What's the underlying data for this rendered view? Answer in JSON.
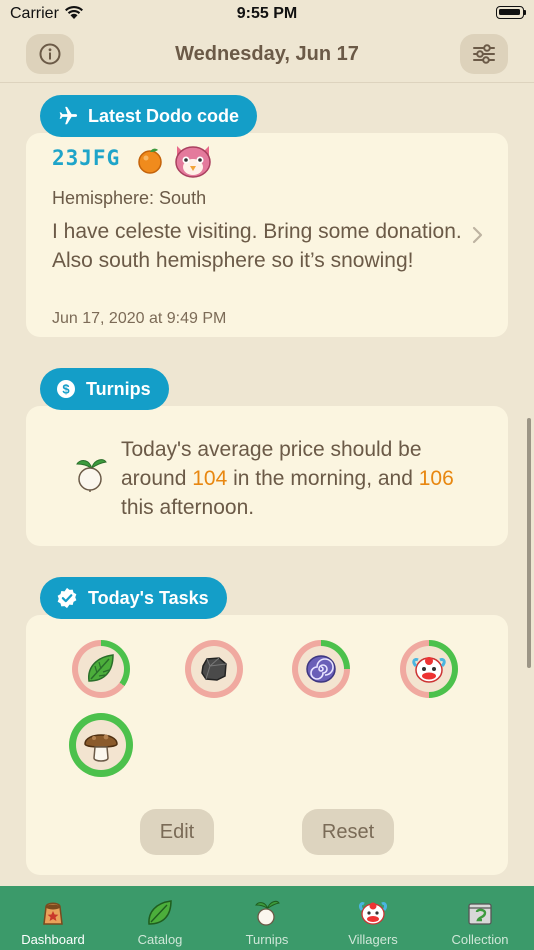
{
  "status": {
    "carrier": "Carrier",
    "time": "9:55 PM"
  },
  "nav": {
    "title": "Wednesday, Jun 17"
  },
  "dodo": {
    "header": "Latest Dodo code",
    "code": "23JFG",
    "hemisphere": "Hemisphere: South",
    "message": "I have celeste visiting. Bring some donation. Also south hemisphere so it’s snowing!",
    "date": "Jun 17, 2020 at 9:49 PM"
  },
  "turnips": {
    "header": "Turnips",
    "text_before": "Today's average price should be around ",
    "morning_price": "104",
    "text_middle": " in the morning, and ",
    "afternoon_price": "106",
    "text_after": " this afternoon."
  },
  "tasks": {
    "header": "Today's Tasks",
    "items": [
      {
        "icon": "leaf-icon",
        "progress": 0.35,
        "ring_color": "#4cc14c"
      },
      {
        "icon": "rock-icon",
        "progress": 0.0,
        "ring_color": "#4cc14c"
      },
      {
        "icon": "fossil-icon",
        "progress": 0.25,
        "ring_color": "#4cc14c"
      },
      {
        "icon": "balloon-icon",
        "progress": 0.5,
        "ring_color": "#4cc14c"
      },
      {
        "icon": "mushroom-icon",
        "progress": 1.0,
        "ring_color": "#4cc14c"
      }
    ],
    "edit_label": "Edit",
    "reset_label": "Reset"
  },
  "tabs": [
    {
      "label": "Dashboard",
      "icon": "dashboard-icon",
      "active": true
    },
    {
      "label": "Catalog",
      "icon": "leaf-icon",
      "active": false
    },
    {
      "label": "Turnips",
      "icon": "turnip-icon",
      "active": false
    },
    {
      "label": "Villagers",
      "icon": "villager-icon",
      "active": false
    },
    {
      "label": "Collection",
      "icon": "collection-icon",
      "active": false
    }
  ],
  "colors": {
    "accent": "#149ec8",
    "background": "#eee6d2",
    "card": "#fbf5e0",
    "price": "#e88710",
    "tabbar": "#3b9a6a",
    "ring_remaining": "#f0a9a0",
    "ring_done": "#4cc14c"
  }
}
